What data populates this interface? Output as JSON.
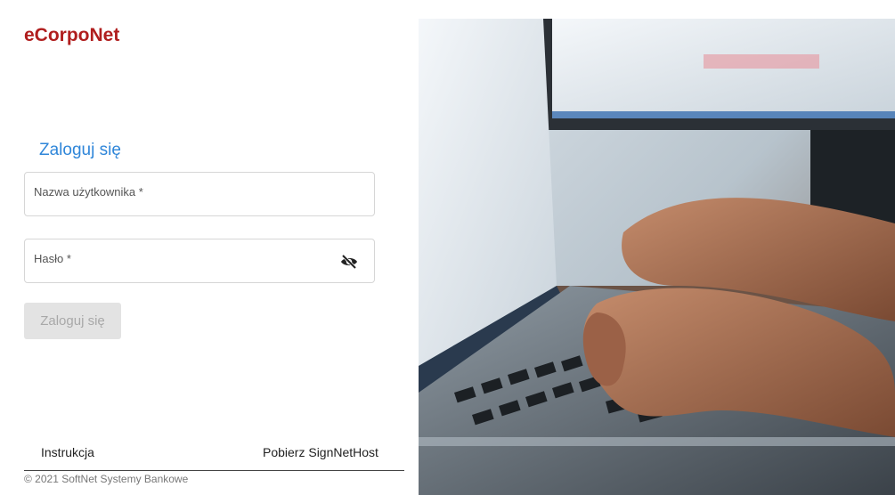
{
  "brand": {
    "name": "eCorpoNet"
  },
  "login": {
    "title": "Zaloguj się",
    "username_label": "Nazwa użytkownika *",
    "password_label": "Hasło *",
    "submit_label": "Zaloguj się"
  },
  "footer": {
    "instrukcja": "Instrukcja",
    "pobierz": "Pobierz SignNetHost",
    "copyright": "© 2021 SoftNet Systemy Bankowe"
  },
  "colors": {
    "brand_red": "#b01e1e",
    "accent_blue": "#2f86d9",
    "disabled_button": "#e3e3e3"
  },
  "icons": {
    "password_toggle": "eye-slash-icon"
  }
}
